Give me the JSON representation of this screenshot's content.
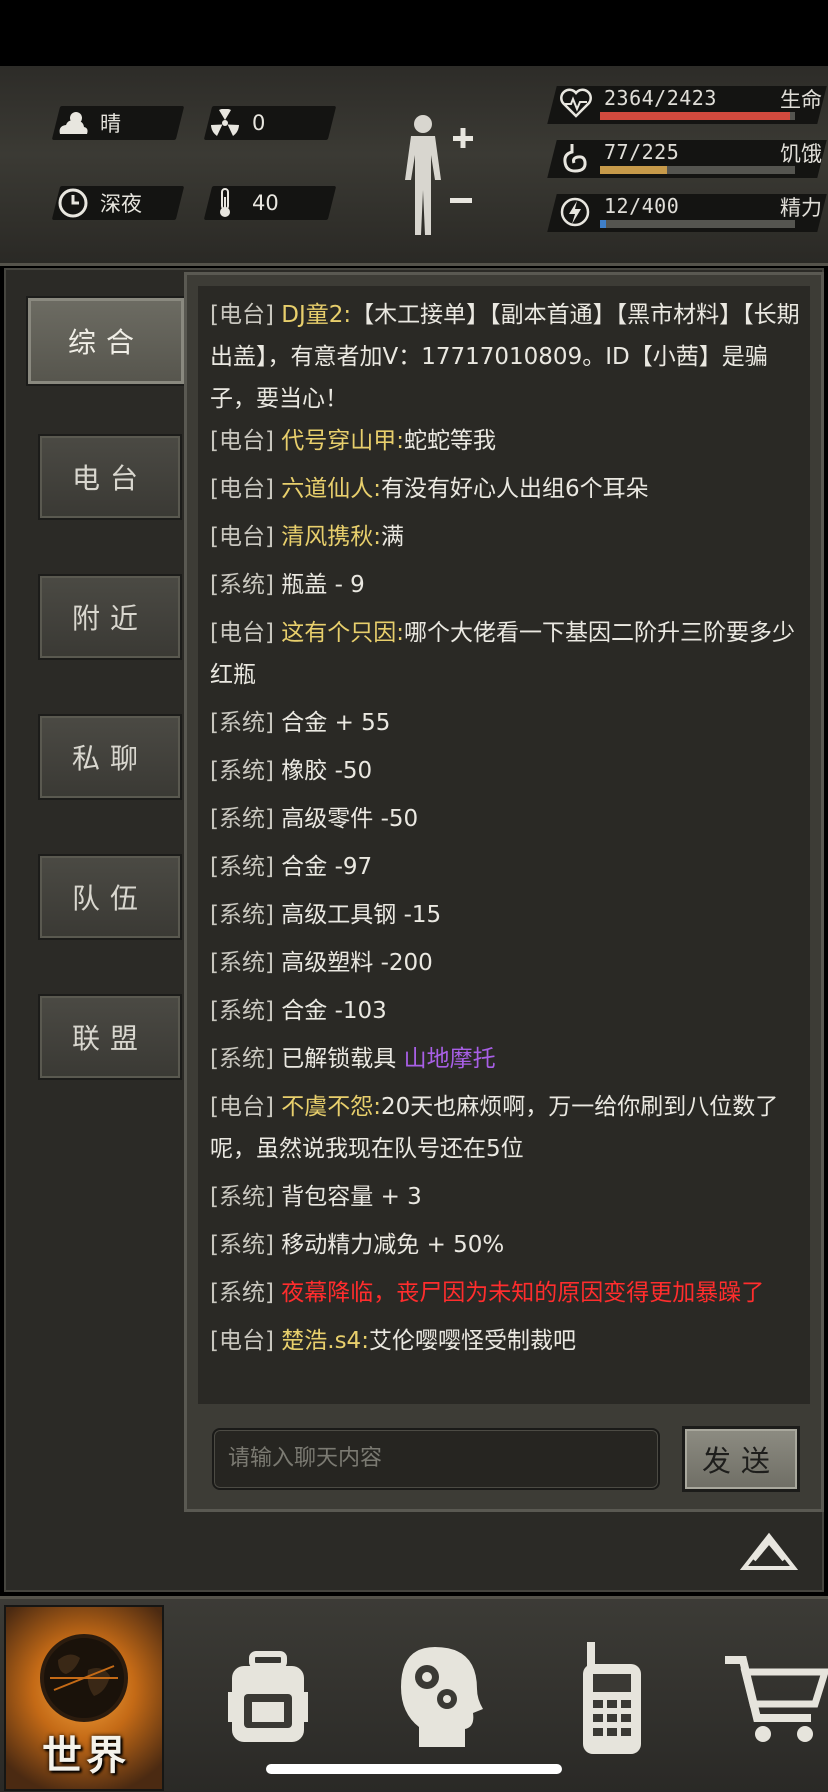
{
  "status": {
    "weather": "晴",
    "radiation": "0",
    "time_of_day": "深夜",
    "temperature": "40"
  },
  "vitals": {
    "health": {
      "value": "2364/2423",
      "label": "生命",
      "fraction": 0.976,
      "color": "#d24a3e"
    },
    "hunger": {
      "value": "77/225",
      "label": "饥饿",
      "fraction": 0.342,
      "color": "#c79a4a"
    },
    "energy": {
      "value": "12/400",
      "label": "精力",
      "fraction": 0.03,
      "color": "#3f7fc8"
    }
  },
  "tabs": [
    {
      "label": "综合",
      "active": true
    },
    {
      "label": "电台",
      "active": false
    },
    {
      "label": "附近",
      "active": false
    },
    {
      "label": "私聊",
      "active": false
    },
    {
      "label": "队伍",
      "active": false
    },
    {
      "label": "联盟",
      "active": false
    }
  ],
  "chat": [
    {
      "channel": "[电台]",
      "name": "DJ童2:",
      "text": "【木工接单】【副本首通】【黑市材料】【长期出盖】，有意者加V：17717010809。ID【小茜】是骗子，要当心！"
    },
    {
      "channel": "[电台]",
      "name": "代号穿山甲:",
      "text": "蛇蛇等我"
    },
    {
      "channel": "[电台]",
      "name": "六道仙人:",
      "text": "有没有好心人出组6个耳朵"
    },
    {
      "channel": "[电台]",
      "name": "清风携秋:",
      "text": "满"
    },
    {
      "channel": "[系统]",
      "text": "瓶盖 - 9"
    },
    {
      "channel": "[电台]",
      "name": "这有个只因:",
      "text": "哪个大佬看一下基因二阶升三阶要多少红瓶"
    },
    {
      "channel": "[系统]",
      "text": "合金 + 55"
    },
    {
      "channel": "[系统]",
      "text": "橡胶 -50"
    },
    {
      "channel": "[系统]",
      "text": "高级零件 -50"
    },
    {
      "channel": "[系统]",
      "text": "合金 -97"
    },
    {
      "channel": "[系统]",
      "text": "高级工具钢 -15"
    },
    {
      "channel": "[系统]",
      "text": "高级塑料 -200"
    },
    {
      "channel": "[系统]",
      "text": "合金 -103"
    },
    {
      "channel": "[系统]",
      "text": "已解锁载具",
      "highlight": "山地摩托"
    },
    {
      "channel": "[电台]",
      "name": "不虞不怨:",
      "text": "20天也麻烦啊，万一给你刷到八位数了呢，虽然说我现在队号还在5位"
    },
    {
      "channel": "[系统]",
      "text": "背包容量 + 3"
    },
    {
      "channel": "[系统]",
      "text": "移动精力减免 + 50%"
    },
    {
      "channel": "[系统]",
      "red": "夜幕降临，丧尸因为未知的原因变得更加暴躁了"
    },
    {
      "channel": "[电台]",
      "name": "楚浩.s4:",
      "text": "艾伦嘤嘤怪受制裁吧"
    }
  ],
  "input": {
    "placeholder": "请输入聊天内容",
    "send_label": "发送"
  },
  "nav": {
    "world_label": "世界"
  },
  "icons": [
    "weather-sunny-icon",
    "radiation-icon",
    "clock-icon",
    "thermometer-icon",
    "body-figure-icon",
    "heart-icon",
    "stomach-icon",
    "energy-icon",
    "chevron-up-icon",
    "globe-icon",
    "backpack-icon",
    "brain-gear-icon",
    "radio-icon",
    "cart-icon"
  ]
}
